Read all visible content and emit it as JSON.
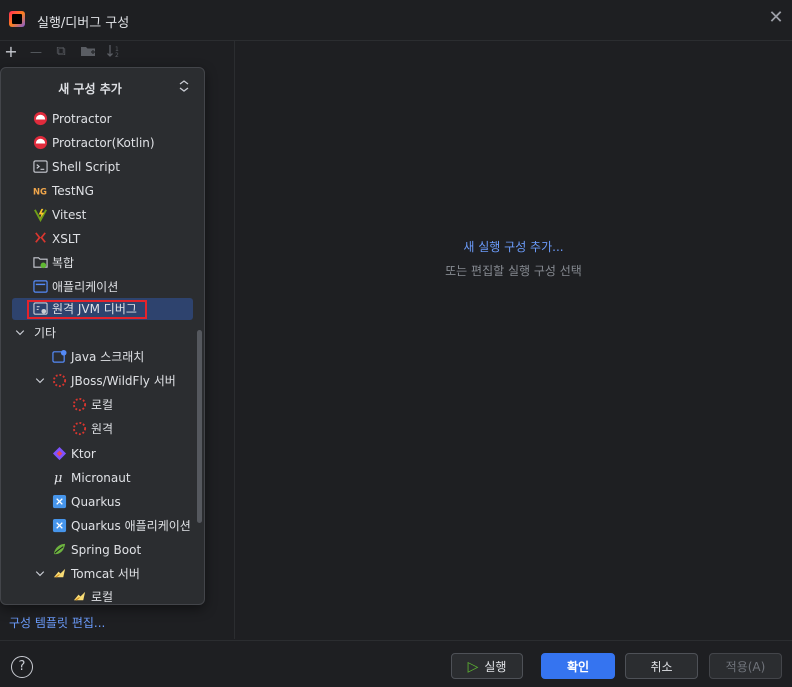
{
  "window": {
    "title": "실행/디버그 구성",
    "close_glyph": "✕"
  },
  "toolbar": {
    "add_glyph": "+",
    "remove_glyph": "—",
    "copy_glyph": "⧉",
    "folder_glyph": "▬",
    "sort_glyph": "↓²"
  },
  "popup": {
    "title": "새 구성 추가",
    "collapse_glyph": "⌃⌄",
    "items": [
      {
        "label": "Protractor",
        "icon": "protractor-icon"
      },
      {
        "label": "Protractor(Kotlin)",
        "icon": "protractor-icon"
      },
      {
        "label": "Shell Script",
        "icon": "shell-script-icon"
      },
      {
        "label": "TestNG",
        "icon": "testng-icon"
      },
      {
        "label": "Vitest",
        "icon": "vitest-icon"
      },
      {
        "label": "XSLT",
        "icon": "xslt-icon"
      },
      {
        "label": "복합",
        "icon": "compound-folder-icon"
      },
      {
        "label": "애플리케이션",
        "icon": "application-icon"
      },
      {
        "label": "원격 JVM 디버그",
        "icon": "remote-jvm-debug-icon",
        "selected": true
      },
      {
        "label": "기타",
        "icon": "chevron-down-icon",
        "group": true
      },
      {
        "label": "Java 스크래치",
        "icon": "java-scratch-icon"
      },
      {
        "label": "JBoss/WildFly 서버",
        "icon": "jboss-icon",
        "group": true
      },
      {
        "label": "로컬",
        "icon": "jboss-icon"
      },
      {
        "label": "원격",
        "icon": "jboss-icon"
      },
      {
        "label": "Ktor",
        "icon": "ktor-icon"
      },
      {
        "label": "Micronaut",
        "icon": "micronaut-icon"
      },
      {
        "label": "Quarkus",
        "icon": "quarkus-icon"
      },
      {
        "label": "Quarkus 애플리케이션",
        "icon": "quarkus-icon"
      },
      {
        "label": "Spring Boot",
        "icon": "spring-boot-icon"
      },
      {
        "label": "Tomcat 서버",
        "icon": "tomcat-icon",
        "group": true
      },
      {
        "label": "로컬",
        "icon": "tomcat-icon"
      }
    ]
  },
  "left_footer": {
    "edit_templates": "구성 템플릿 편집..."
  },
  "main": {
    "add_new": "새 실행 구성 추가...",
    "or_select": "또는 편집할 실행 구성 선택"
  },
  "footer": {
    "help_glyph": "?",
    "run_label": "실행",
    "run_glyph": "▷",
    "ok_label": "확인",
    "cancel_label": "취소",
    "apply_label": "적용(A)"
  },
  "colors": {
    "background": "#1e1f22",
    "popup_bg": "#2b2d30",
    "selection": "#2e436e",
    "highlight_border": "#e5232b",
    "link": "#6b9bfa",
    "primary_button": "#3574f0"
  }
}
